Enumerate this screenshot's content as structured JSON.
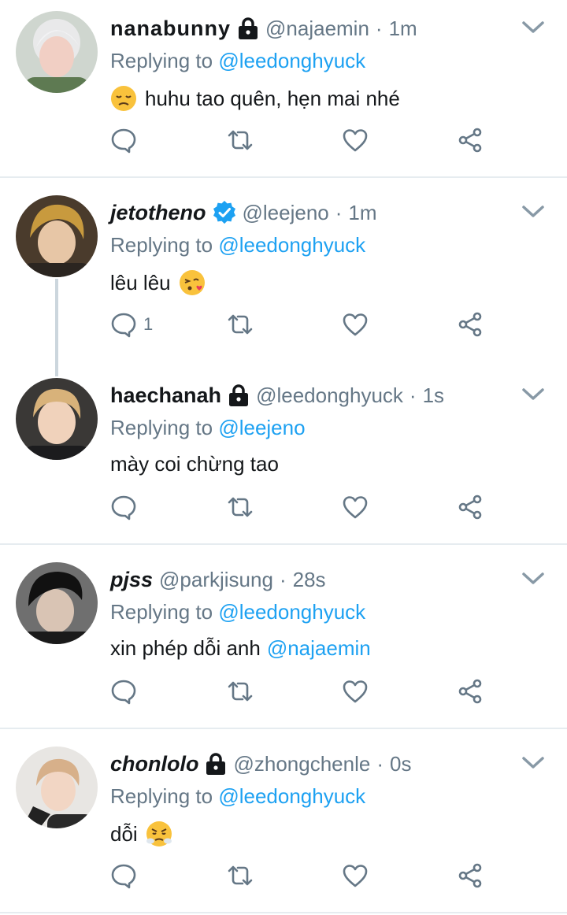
{
  "colors": {
    "link": "#1da1f2",
    "muted": "#657786",
    "text": "#14171a",
    "divider": "#e6ecf0",
    "verified": "#1da1f2"
  },
  "reply_prefix": "Replying to",
  "tweets": [
    {
      "display_name": "nanabunny",
      "badge": "lock-icon",
      "handle": "@najaemin",
      "time": "1m",
      "reply_to": "@leedonghyuck",
      "text": "huhu tao quên, hẹn mai nhé",
      "emoji_lead": "pensive-face-emoji",
      "reply_count": ""
    },
    {
      "display_name": "jetotheno",
      "badge": "verified-icon",
      "handle": "@leejeno",
      "time": "1m",
      "reply_to": "@leedonghyuck",
      "text": "lêu lêu",
      "emoji_trail": "kissing-heart-emoji",
      "reply_count": "1"
    },
    {
      "display_name": "haechanah",
      "badge": "lock-icon",
      "handle": "@leedonghyuck",
      "time": "1s",
      "reply_to": "@leejeno",
      "text": "mày coi chừng tao",
      "reply_count": ""
    },
    {
      "display_name": "pjss",
      "handle": "@parkjisung",
      "time": "28s",
      "reply_to": "@leedonghyuck",
      "text": "xin phép dỗi anh",
      "text_mention": "@najaemin",
      "reply_count": ""
    },
    {
      "display_name": "chonlolo",
      "badge": "lock-icon",
      "handle": "@zhongchenle",
      "time": "0s",
      "reply_to": "@leedonghyuck",
      "text": "dỗi",
      "emoji_trail": "triumph-face-emoji",
      "reply_count": ""
    }
  ]
}
